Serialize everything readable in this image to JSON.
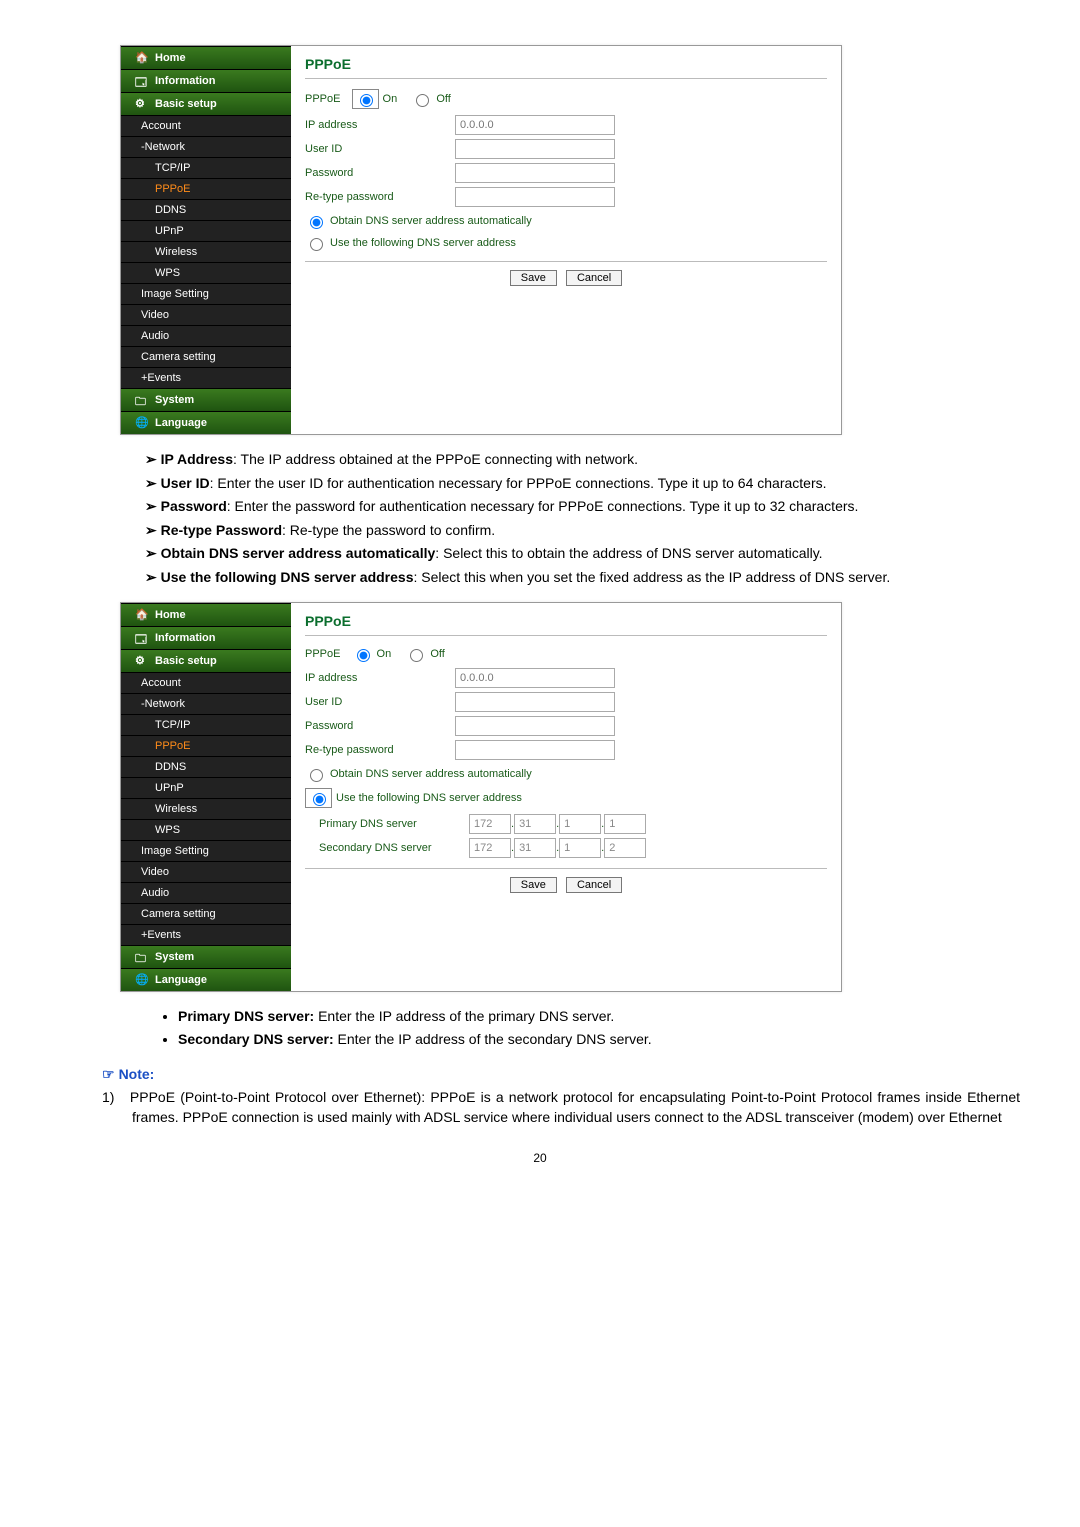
{
  "sidebar": {
    "home": "Home",
    "information": "Information",
    "basic": "Basic setup",
    "account": "Account",
    "network": "-Network",
    "tcpip": "TCP/IP",
    "pppoe": "PPPoE",
    "ddns": "DDNS",
    "upnp": "UPnP",
    "wireless": "Wireless",
    "wps": "WPS",
    "image": "Image Setting",
    "video": "Video",
    "audio": "Audio",
    "camera": "Camera setting",
    "events": "+Events",
    "system": "System",
    "language": "Language"
  },
  "form": {
    "title": "PPPoE",
    "pppoe_label": "PPPoE",
    "on": "On",
    "off": "Off",
    "ip_label": "IP address",
    "ip_placeholder": "0.0.0.0",
    "user_label": "User ID",
    "pw_label": "Password",
    "repw_label": "Re-type password",
    "dns_auto": "Obtain DNS server address automatically",
    "dns_manual": "Use the following DNS server address",
    "pdns": "Primary DNS server",
    "sdns": "Secondary DNS server",
    "p1": "172",
    "p2": "31",
    "p3": "1",
    "p4": "1",
    "s1": "172",
    "s2": "31",
    "s3": "1",
    "s4": "2",
    "save": "Save",
    "cancel": "Cancel"
  },
  "desc": {
    "ip_b": "IP Address",
    "ip_t": ": The IP address obtained at the PPPoE connecting with network.",
    "uid_b": "User ID",
    "uid_t": ": Enter the user ID for authentication necessary for PPPoE connections. Type it up to 64 characters.",
    "pw_b": "Password",
    "pw_t": ": Enter the password for authentication necessary for PPPoE connections. Type it up to 32 characters.",
    "rpw_b": "Re-type Password",
    "rpw_t": ": Re-type the password to confirm.",
    "auto_b": "Obtain DNS server address automatically",
    "auto_t": ": Select this to obtain the address of DNS server automatically.",
    "man_b": "Use the following DNS server address",
    "man_t": ": Select this when you set the fixed address as the IP address of DNS server.",
    "pdns_b": "Primary DNS server:",
    "pdns_t": " Enter the IP address of the primary DNS server.",
    "sdns_b": "Secondary DNS server:",
    "sdns_t": " Enter the IP address of the secondary DNS server."
  },
  "note": {
    "title": "Note:",
    "n1_num": "1)",
    "n1": "PPPoE (Point-to-Point Protocol over Ethernet): PPPoE is a network protocol for encapsulating Point-to-Point Protocol frames inside Ethernet frames. PPPoE connection is used mainly with ADSL service where individual users connect to the ADSL transceiver (modem) over Ethernet"
  },
  "page": "20"
}
